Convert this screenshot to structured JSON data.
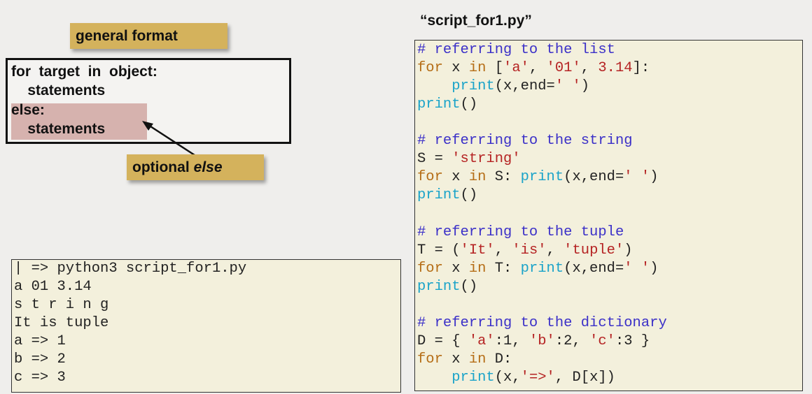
{
  "labels": {
    "general_format": "general format",
    "optional": "optional",
    "optional_else": "else"
  },
  "format_box": {
    "line1": "for  target  in  object:",
    "line2": "    statements",
    "line3": "else:",
    "line4": "    statements"
  },
  "file_title": "“script_for1.py”",
  "code": {
    "l1": "# referring to the list",
    "l2": {
      "kw1": "for",
      "t1": " x ",
      "kw2": "in",
      "t2": " [",
      "s1": "'a'",
      "t3": ", ",
      "s2": "'01'",
      "t4": ", ",
      "s3": "3.14",
      "t5": "]:"
    },
    "l3": {
      "indent": "    ",
      "fn": "print",
      "t1": "(x,end=",
      "s1": "' '",
      "t2": ")"
    },
    "l4": {
      "fn": "print",
      "t1": "()"
    },
    "l6": "# referring to the string",
    "l7": {
      "t1": "S = ",
      "s1": "'string'"
    },
    "l8": {
      "kw1": "for",
      "t1": " x ",
      "kw2": "in",
      "t2": " S: ",
      "fn": "print",
      "t3": "(x,end=",
      "s1": "' '",
      "t4": ")"
    },
    "l9": {
      "fn": "print",
      "t1": "()"
    },
    "l11": "# referring to the tuple",
    "l12": {
      "t1": "T = (",
      "s1": "'It'",
      "t2": ", ",
      "s2": "'is'",
      "t3": ", ",
      "s3": "'tuple'",
      "t4": ")"
    },
    "l13": {
      "kw1": "for",
      "t1": " x ",
      "kw2": "in",
      "t2": " T: ",
      "fn": "print",
      "t3": "(x,end=",
      "s1": "' '",
      "t4": ")"
    },
    "l14": {
      "fn": "print",
      "t1": "()"
    },
    "l16": "# referring to the dictionary",
    "l17": {
      "t1": "D = { ",
      "s1": "'a'",
      "t2": ":1, ",
      "s2": "'b'",
      "t3": ":2, ",
      "s3": "'c'",
      "t4": ":3 }"
    },
    "l18": {
      "kw1": "for",
      "t1": " x ",
      "kw2": "in",
      "t2": " D:"
    },
    "l19": {
      "indent": "    ",
      "fn": "print",
      "t1": "(x,",
      "s1": "'=>'",
      "t2": ", D[x])"
    }
  },
  "terminal": {
    "lines": [
      "| => python3 script_for1.py",
      "a 01 3.14",
      "s t r i n g",
      "It is tuple",
      "a => 1",
      "b => 2",
      "c => 3"
    ]
  },
  "colors": {
    "label_bg": "#d4b25c",
    "else_highlight": "#d6b2ae",
    "code_bg": "#f3f0dc",
    "comment": "#3b30c8",
    "keyword": "#b56d16",
    "string": "#b52323",
    "builtin": "#1aa3c9"
  }
}
